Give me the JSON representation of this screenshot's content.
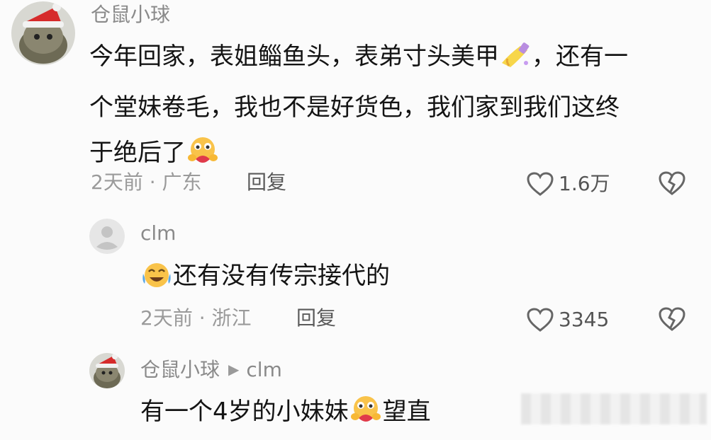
{
  "comments": [
    {
      "username": "仓鼠小球",
      "lines": [
        "今年回家，表姐鲻鱼头，表弟寸头美甲",
        "，还有一",
        "个堂妹卷毛，我也不是好货色，我们家到我们这终",
        "于绝后了"
      ],
      "meta": "2天前 · 广东",
      "reply_label": "回复",
      "likes": "1.6万"
    },
    {
      "username": "clm",
      "text": "还有没有传宗接代的",
      "meta": "2天前 · 浙江",
      "reply_label": "回复",
      "likes": "3345"
    },
    {
      "username": "仓鼠小球",
      "reply_to": "clm",
      "text_before": "有一个4岁的小妹妹",
      "text_after": "望直"
    }
  ],
  "icons": {
    "heart": "heart-outline-icon",
    "dislike": "broken-heart-icon",
    "nail": "nail-polish-emoji",
    "hug": "hugging-face-emoji",
    "laugh_cry": "laughing-crying-emoji"
  },
  "colors": {
    "background": "#fbfbfb",
    "username": "#8a8a8a",
    "meta": "#9a9a9a",
    "text": "#141414"
  }
}
